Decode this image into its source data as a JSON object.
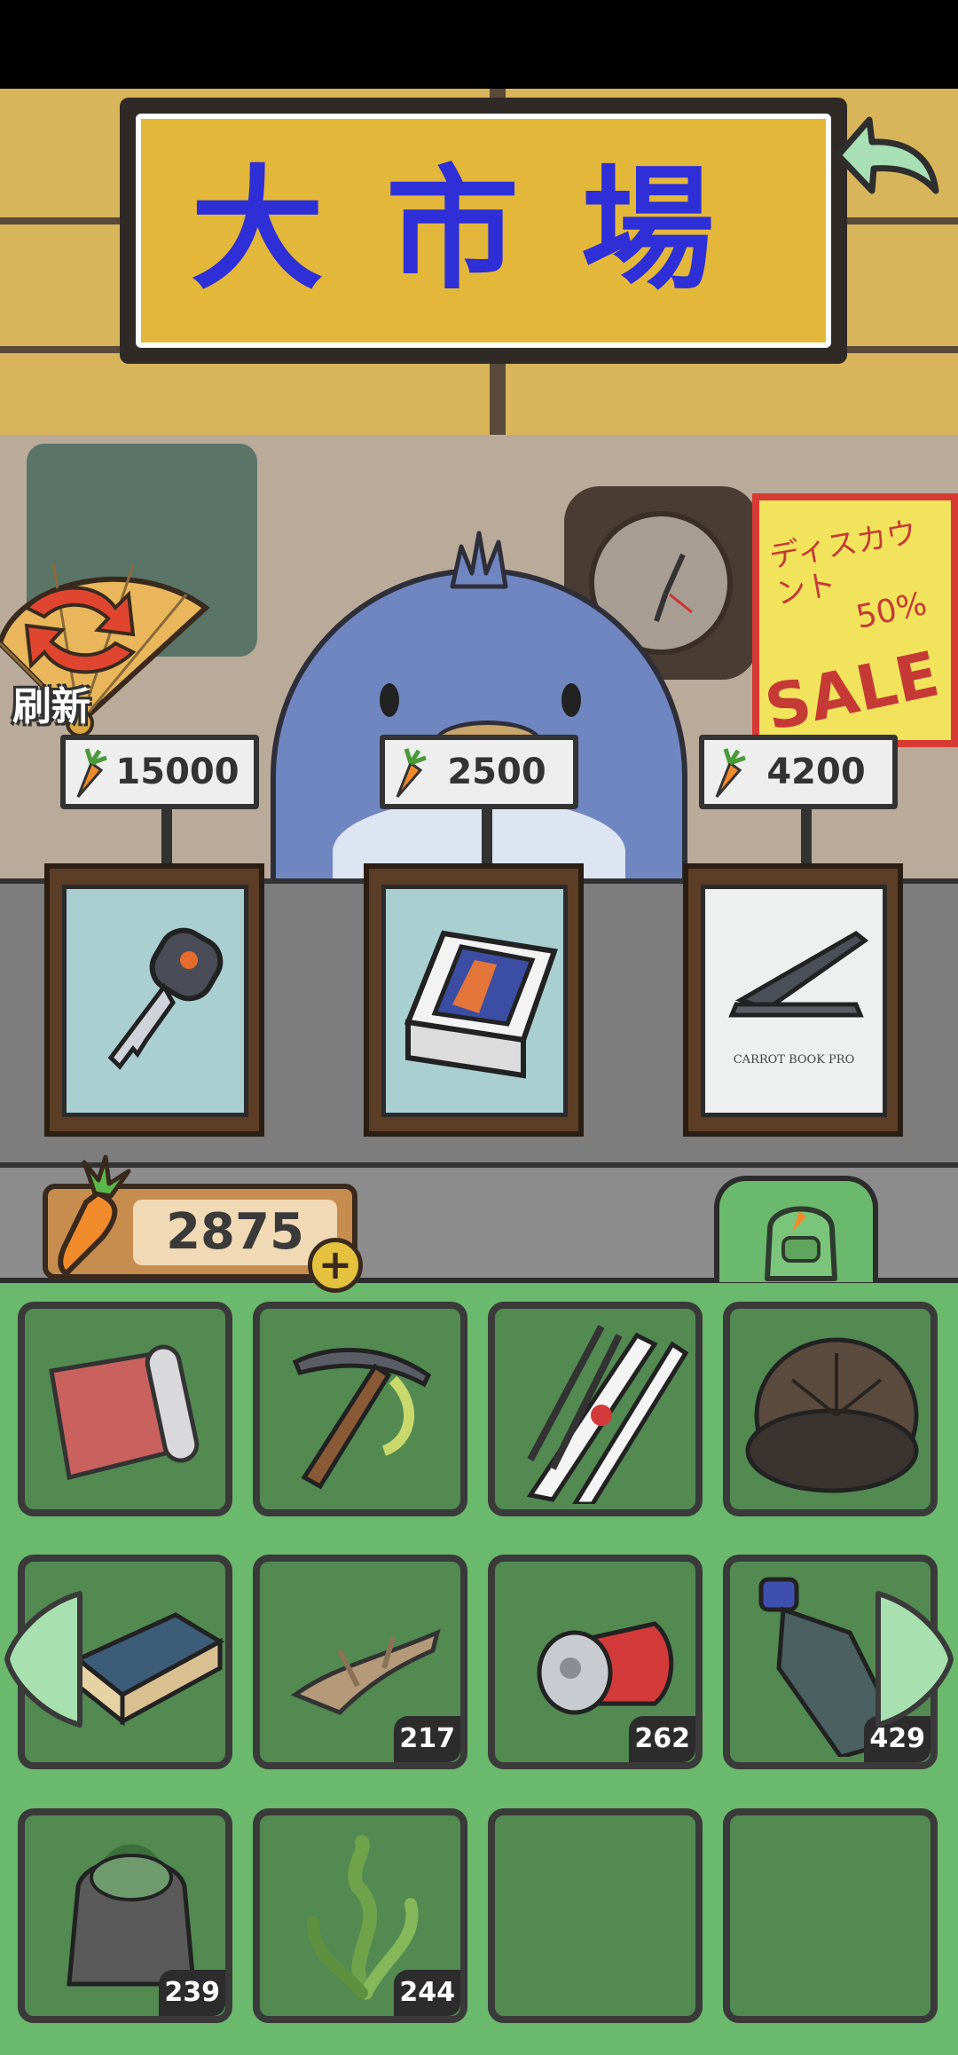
{
  "shop": {
    "title": "大市場",
    "refresh_label": "刷新",
    "sale_poster": {
      "line1": "ディスカウント",
      "percent": "50%",
      "sale": "SALE"
    },
    "currency_icon": "carrot-icon",
    "items": [
      {
        "name": "car-key",
        "icon": "car-key-icon",
        "price": "15000"
      },
      {
        "name": "smartphone-box",
        "icon": "phone-box-icon",
        "price": "2500"
      },
      {
        "name": "laptop",
        "icon": "laptop-icon",
        "price": "4200",
        "label": "CARROT BOOK PRO"
      }
    ]
  },
  "wallet": {
    "carrots": "2875",
    "add_symbol": "+"
  },
  "inventory": {
    "tab_icon": "backpack-icon",
    "slots": [
      {
        "icon": "rolled-mat-icon",
        "qty": ""
      },
      {
        "icon": "pickaxe-icon",
        "qty": ""
      },
      {
        "icon": "ski-poles-icon",
        "qty": ""
      },
      {
        "icon": "fur-hat-icon",
        "qty": ""
      },
      {
        "icon": "matchbox-icon",
        "qty": ""
      },
      {
        "icon": "driftwood-icon",
        "qty": "217"
      },
      {
        "icon": "crushed-can-icon",
        "qty": "262"
      },
      {
        "icon": "plastic-bottle-icon",
        "qty": "429"
      },
      {
        "icon": "old-bag-icon",
        "qty": "239"
      },
      {
        "icon": "seaweed-icon",
        "qty": "244"
      },
      {
        "icon": "",
        "qty": ""
      },
      {
        "icon": "",
        "qty": ""
      }
    ]
  },
  "colors": {
    "sign_text": "#2e2fd6",
    "inventory_bg": "#6ab96c",
    "slot_bg": "#528a52"
  }
}
